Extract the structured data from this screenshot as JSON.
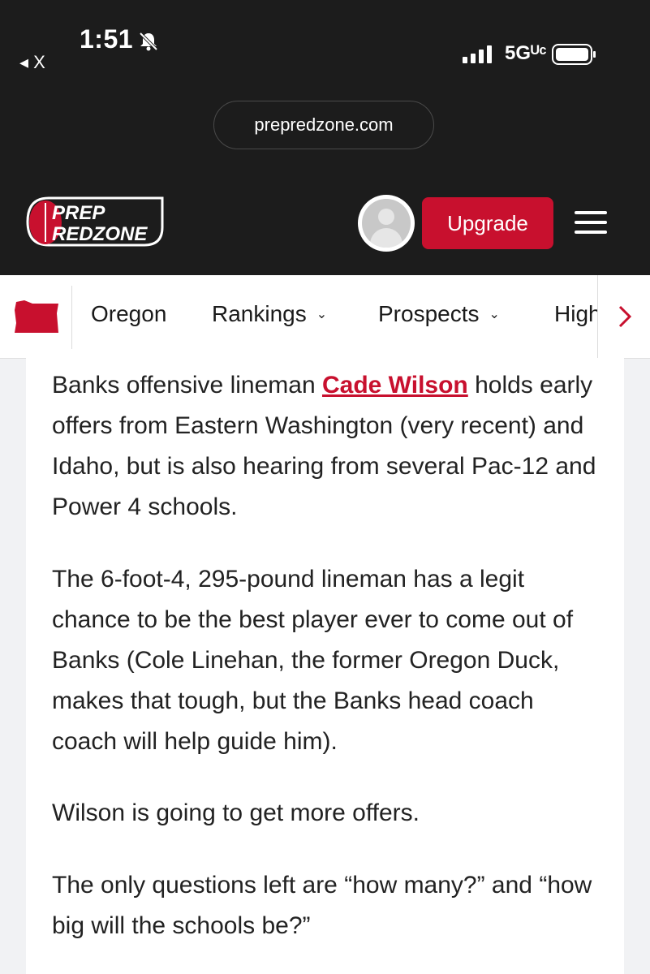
{
  "status_bar": {
    "time": "1:51",
    "back_label": "◂ X",
    "network": "5Gᵁᶜ"
  },
  "browser": {
    "url": "prepredzone.com"
  },
  "header": {
    "logo_line1": "PREP",
    "logo_line2": "REDZONE",
    "upgrade_label": "Upgrade",
    "accent": "#c8102e"
  },
  "nav": {
    "state": "Oregon",
    "items": [
      "Rankings",
      "Prospects",
      "High"
    ]
  },
  "article": {
    "p1_before": "Banks offensive lineman ",
    "p1_link": "Cade Wilson",
    "p1_after": " holds early offers from Eastern Washington (very recent) and Idaho, but is also hearing from several Pac-12 and Power 4 schools.",
    "p2": "The 6-foot-4, 295-pound lineman has a legit chance to be the best player ever to come out of Banks (Cole Linehan, the former Oregon Duck, makes that tough, but the Banks head coach coach will help guide him).",
    "p3": "Wilson is going to get more offers.",
    "p4": "The only questions left are “how many?” and “how big will the schools be?”"
  }
}
